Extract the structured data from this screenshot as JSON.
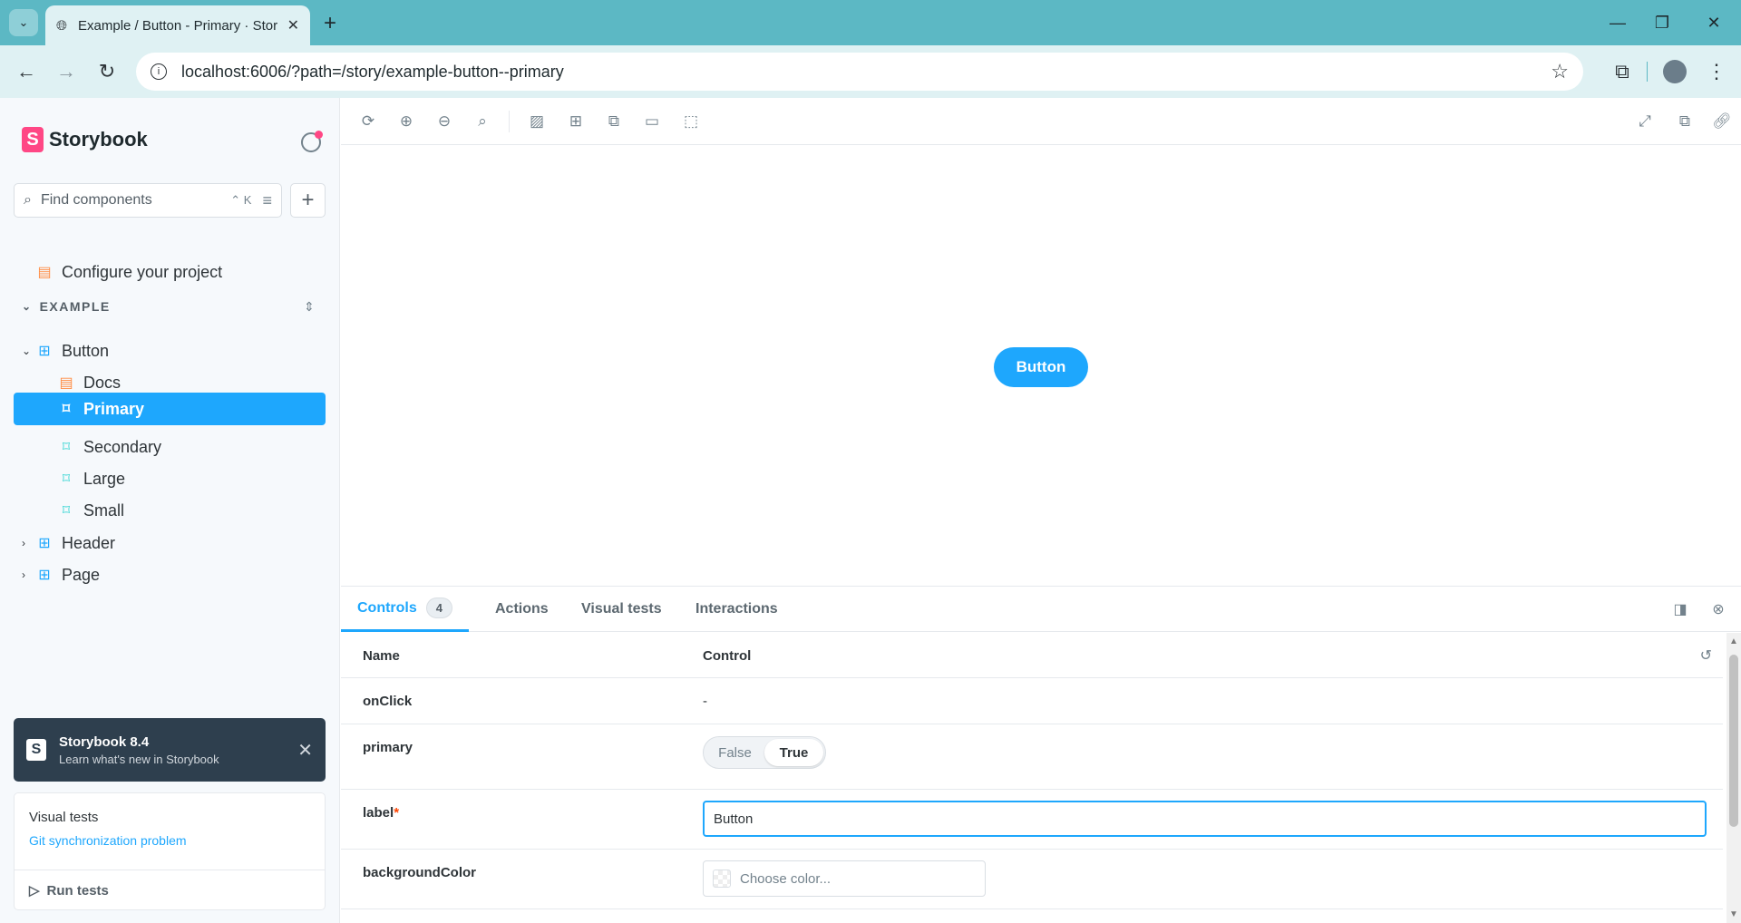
{
  "browser": {
    "tab_title": "Example / Button - Primary · Storybook",
    "url": "localhost:6006/?path=/story/example-button--primary",
    "new_tab": "+",
    "tab_close": "✕",
    "win_min": "—",
    "win_restore": "❐",
    "win_close": "✕"
  },
  "sidebar": {
    "brand": "Storybook",
    "search_placeholder": "Find components",
    "search_shortcut": "⌃ K",
    "configure_label": "Configure your project",
    "section_label": "EXAMPLE",
    "tree": {
      "button": "Button",
      "docs": "Docs",
      "primary": "Primary",
      "secondary": "Secondary",
      "large": "Large",
      "small": "Small",
      "header": "Header",
      "page": "Page"
    },
    "notice": {
      "title": "Storybook 8.4",
      "subtitle": "Learn what's new in Storybook"
    },
    "tests": {
      "heading": "Visual tests",
      "link": "Git synchronization problem",
      "run_label": "Run tests"
    }
  },
  "preview": {
    "button_label": "Button"
  },
  "addons": {
    "tabs": {
      "controls": "Controls",
      "controls_count": "4",
      "actions": "Actions",
      "visual_tests": "Visual tests",
      "interactions": "Interactions"
    },
    "table": {
      "head_name": "Name",
      "head_control": "Control",
      "rows": {
        "onclick": {
          "name": "onClick",
          "value": "-"
        },
        "primary": {
          "name": "primary",
          "false_label": "False",
          "true_label": "True",
          "selected": "True"
        },
        "label": {
          "name": "label",
          "required_mark": "*",
          "value": "Button"
        },
        "bg": {
          "name": "backgroundColor",
          "placeholder": "Choose color..."
        }
      }
    }
  },
  "colors": {
    "accent": "#1ea7fd",
    "brand": "#ff4785",
    "browser_frame": "#5cb8c4",
    "notice_bg": "#2e3f4e"
  }
}
